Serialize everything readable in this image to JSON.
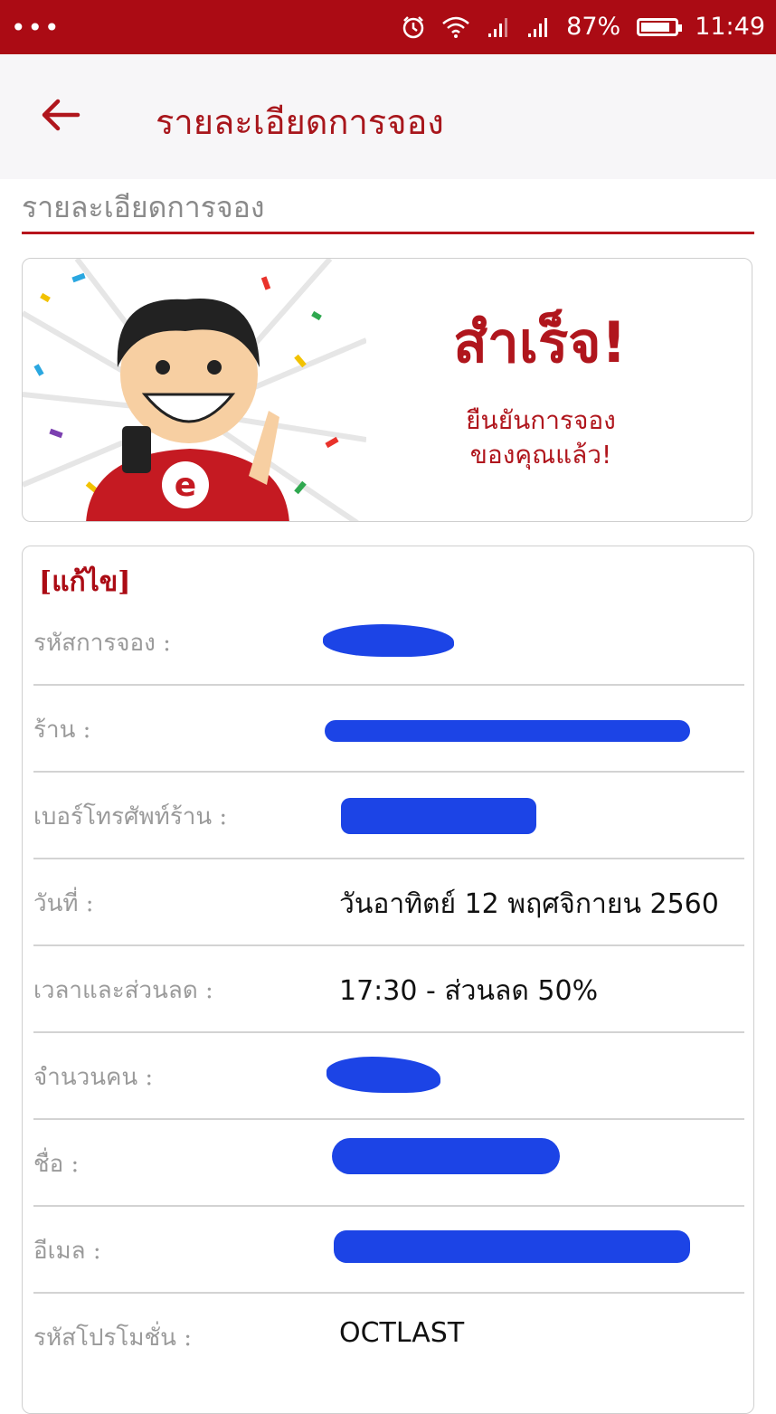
{
  "status_bar": {
    "more": "•••",
    "battery_percent": "87%",
    "battery_level": 0.87,
    "time": "11:49"
  },
  "toolbar": {
    "title": "รายละเอียดการจอง"
  },
  "section": {
    "title": "รายละเอียดการจอง"
  },
  "success": {
    "headline": "สำเร็จ!",
    "line1": "ยืนยันการจอง",
    "line2": "ของคุณแล้ว!"
  },
  "details": {
    "edit_label": "[แก้ไข]",
    "rows": [
      {
        "label": "รหัสการจอง :",
        "value": ""
      },
      {
        "label": "ร้าน :",
        "value": ""
      },
      {
        "label": "เบอร์โทรศัพท์ร้าน :",
        "value": ""
      },
      {
        "label": "วันที่ :",
        "value": "วันอาทิตย์ 12 พฤศจิกายน 2560"
      },
      {
        "label": "เวลาและส่วนลด :",
        "value": "17:30  - ส่วนลด 50%"
      },
      {
        "label": "จำนวนคน :",
        "value": ""
      },
      {
        "label": "ชื่อ :",
        "value": ""
      },
      {
        "label": "อีเมล :",
        "value": ""
      },
      {
        "label": "รหัสโปรโมชั่น :",
        "value": "OCTLAST"
      }
    ]
  },
  "colors": {
    "brand_red": "#ab0b14",
    "toolbar_bg": "#f7f6f8",
    "redaction_blue": "#1c44e6"
  }
}
